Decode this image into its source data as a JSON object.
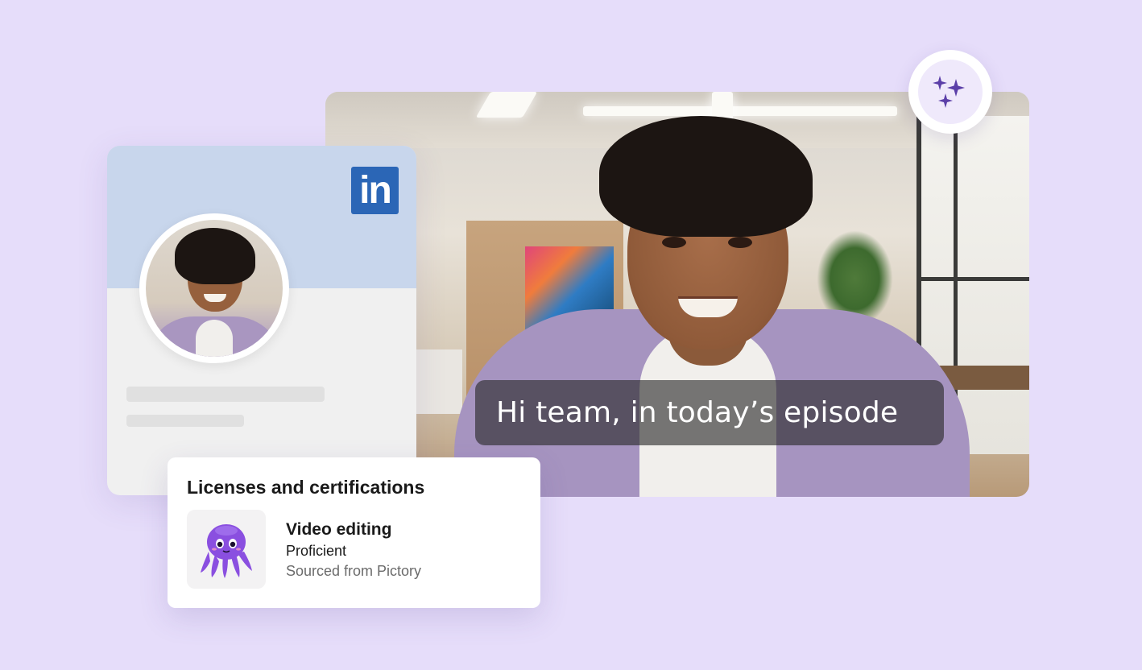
{
  "video": {
    "caption": "Hi team, in today’s episode"
  },
  "badge": {
    "icon": "sparkles-icon",
    "accent": "#5b3fa8"
  },
  "profile": {
    "brand_logo_text": "in",
    "brand_color": "#2b66b6",
    "banner_color": "#c8d6ec"
  },
  "certifications": {
    "title": "Licenses and certifications",
    "items": [
      {
        "name": "Video editing",
        "level": "Proficient",
        "source": "Sourced from Pictory",
        "icon": "octopus-icon"
      }
    ]
  },
  "colors": {
    "background": "#e6ddfa",
    "octopus": "#8a4fe0"
  }
}
